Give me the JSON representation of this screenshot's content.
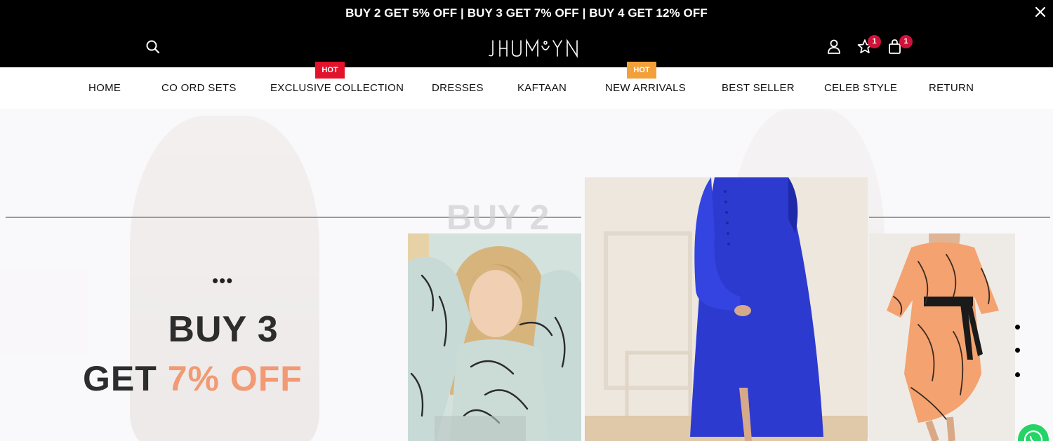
{
  "announcement": {
    "text": "BUY 2 GET 5% OFF | BUY 3 GET 7% OFF | BUY 4 GET 12% OFF"
  },
  "header": {
    "logo_text": "JHUMKYN",
    "wishlist_count": "1",
    "cart_count": "1"
  },
  "nav": {
    "items": [
      {
        "label": "HOME"
      },
      {
        "label": "CO ORD SETS"
      },
      {
        "label": "EXCLUSIVE COLLECTION",
        "tag": "HOT"
      },
      {
        "label": "DRESSES"
      },
      {
        "label": "KAFTAAN"
      },
      {
        "label": "NEW ARRIVALS",
        "tag": "HOT"
      },
      {
        "label": "BEST SELLER"
      },
      {
        "label": "CELEB STYLE"
      },
      {
        "label": "RETURN"
      }
    ]
  },
  "hero": {
    "line1": "BUY 3",
    "line2_prefix": "GET ",
    "line2_accent": "7% OFF",
    "watermark": "BUY 2"
  },
  "colors": {
    "hot_red": "#e3132b",
    "hot_orange": "#f3a03a",
    "badge": "#d0123a",
    "accent": "#f19a74"
  }
}
